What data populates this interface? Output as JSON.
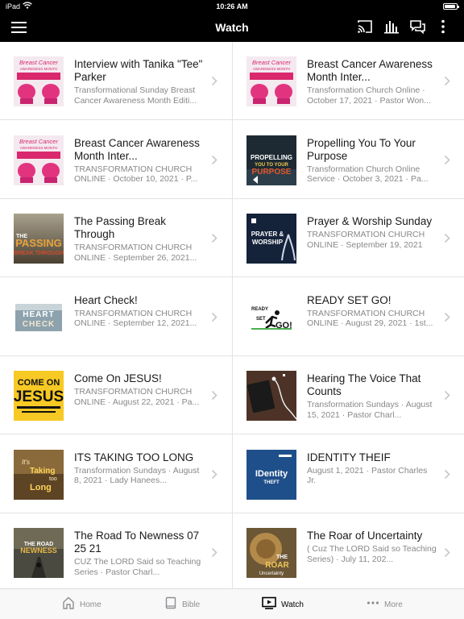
{
  "status_bar": {
    "device": "iPad",
    "time": "10:26 AM"
  },
  "header": {
    "title": "Watch",
    "icons": [
      "menu-icon",
      "cast-icon",
      "audio-bars-icon",
      "chat-icon",
      "more-vertical-icon"
    ]
  },
  "colors": {
    "header_bg": "#000000",
    "divider": "#e3e3e3",
    "subtitle": "#888888",
    "chevron": "#c7c7cc",
    "tabbar_bg": "#f8f8f8"
  },
  "items": [
    {
      "title": "Interview with Tanika \"Tee\" Parker",
      "subtitle": "Transformational Sunday Breast Cancer Awareness Month Editi...",
      "thumb": {
        "kind": "breast",
        "lines": [
          "Breast Cancer",
          "AWARENESS MONTH"
        ]
      }
    },
    {
      "title": "Breast Cancer Awareness Month Inter...",
      "subtitle": "Transformation Church Online · October 17, 2021 · Pastor Won...",
      "thumb": {
        "kind": "breast",
        "lines": [
          "Breast Cancer",
          "AWARENESS MONTH"
        ]
      }
    },
    {
      "title": "Breast Cancer Awareness Month Inter...",
      "subtitle": "TRANSFORMATION CHURCH ONLINE · October 10, 2021 · P...",
      "thumb": {
        "kind": "breast",
        "lines": [
          "Breast Cancer",
          "AWARENESS MONTH"
        ]
      }
    },
    {
      "title": "Propelling You To Your Purpose",
      "subtitle": "Transformation Church Online Service · October 3, 2021 · Pa...",
      "thumb": {
        "kind": "propel",
        "lines": [
          "PROPELLING",
          "YOU TO YOUR",
          "PURPOSE"
        ]
      }
    },
    {
      "title": "The Passing Break Through",
      "subtitle": "TRANSFORMATION CHURCH ONLINE · September 26, 2021...",
      "thumb": {
        "kind": "passing",
        "lines": [
          "THE",
          "PASSING",
          "BREAK THROUGH"
        ]
      }
    },
    {
      "title": "Prayer & Worship Sunday",
      "subtitle": "TRANSFORMATION CHURCH ONLINE · September 19, 2021",
      "thumb": {
        "kind": "prayer",
        "lines": [
          "PRAYER &",
          "WORSHIP"
        ]
      }
    },
    {
      "title": "Heart Check!",
      "subtitle": "TRANSFORMATION CHURCH ONLINE · September 12, 2021...",
      "thumb": {
        "kind": "heart",
        "lines": [
          "HEART",
          "CHECK"
        ]
      }
    },
    {
      "title": "READY SET GO!",
      "subtitle": "TRANSFORMATION CHURCH ONLINE · August 29, 2021 · 1st...",
      "thumb": {
        "kind": "ready",
        "lines": [
          "READY",
          "SET",
          "GO!"
        ]
      }
    },
    {
      "title": "Come On JESUS!",
      "subtitle": "TRANSFORMATION CHURCH ONLINE · August 22, 2021 · Pa...",
      "thumb": {
        "kind": "jesus",
        "lines": [
          "COME ON",
          "JESUS"
        ]
      }
    },
    {
      "title": "Hearing The Voice That Counts",
      "subtitle": "Transformation Sundays · August 15, 2021 · Pastor Charl...",
      "thumb": {
        "kind": "voice",
        "lines": []
      }
    },
    {
      "title": "ITS TAKING TOO LONG",
      "subtitle": "Transformation Sundays · August 8, 2021 · Lady Hanees...",
      "thumb": {
        "kind": "taking",
        "lines": [
          "It's",
          "Taking",
          "too",
          "Long"
        ]
      }
    },
    {
      "title": "IDENTITY THEIF",
      "subtitle": "August 1, 2021 · Pastor Charles Jr.",
      "thumb": {
        "kind": "identity",
        "lines": [
          "IDentity",
          "THEFT"
        ]
      }
    },
    {
      "title": "The Road To Newness 07 25 21",
      "subtitle": "CUZ The LORD Said so Teaching Series · Pastor Charl...",
      "thumb": {
        "kind": "road",
        "lines": [
          "THE ROAD",
          "NEWNESS"
        ]
      }
    },
    {
      "title": "The Roar of Uncertainty",
      "subtitle": "( Cuz The LORD Said so Teaching Series) · July 11, 202...",
      "thumb": {
        "kind": "roar",
        "lines": [
          "THE",
          "ROAR",
          "Uncertainty"
        ]
      }
    }
  ],
  "tabbar": {
    "tabs": [
      {
        "label": "Home",
        "icon": "home-icon",
        "active": false
      },
      {
        "label": "Bible",
        "icon": "book-icon",
        "active": false
      },
      {
        "label": "Watch",
        "icon": "video-icon",
        "active": true
      },
      {
        "label": "More",
        "icon": "ellipsis-icon",
        "active": false
      }
    ]
  }
}
